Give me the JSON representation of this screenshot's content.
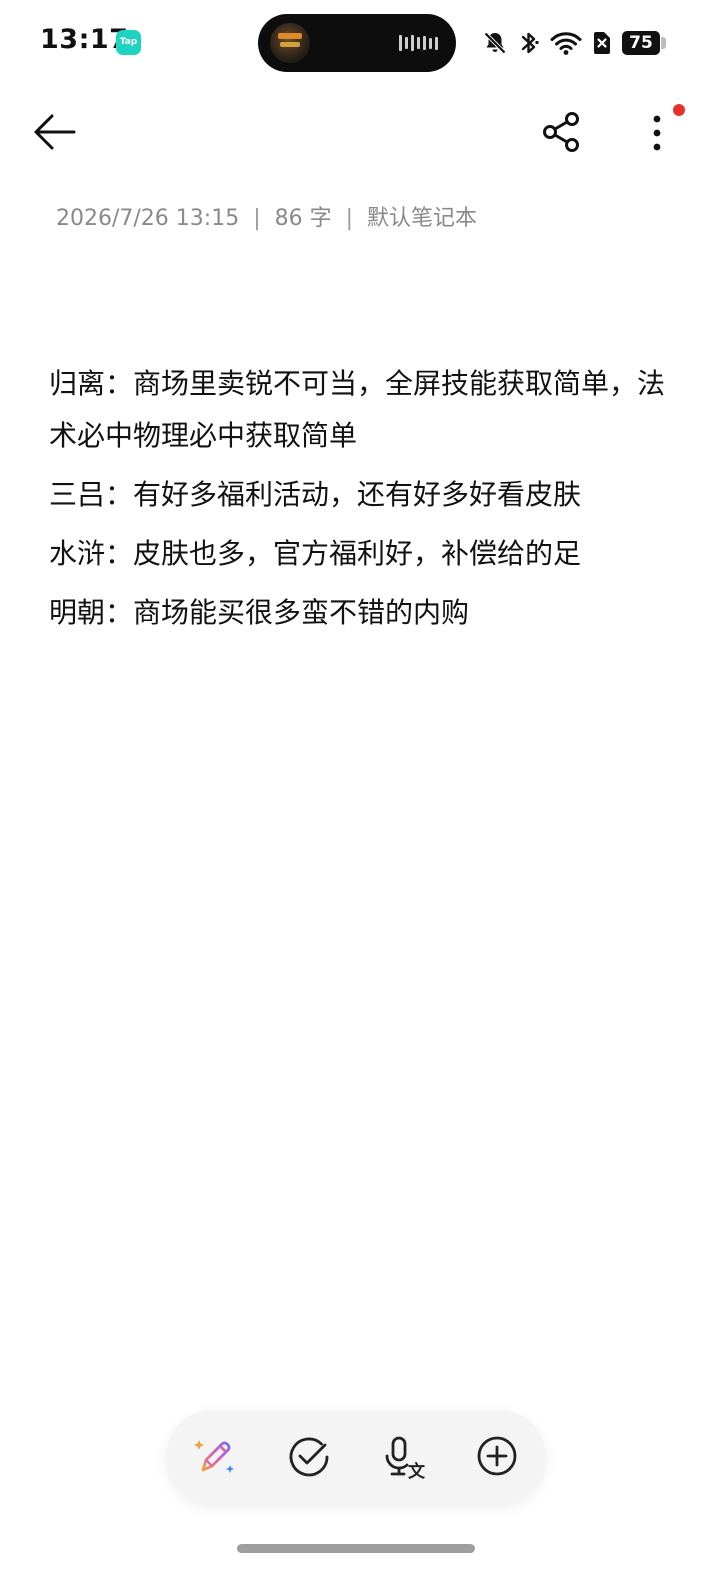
{
  "status_bar": {
    "time": "13:17",
    "app_badge": "Tap",
    "battery_level": "75",
    "icons": [
      "bell-off-icon",
      "bluetooth-icon",
      "wifi-icon",
      "sim-off-icon",
      "battery-icon"
    ]
  },
  "toolbar": {
    "back_icon": "arrow-left-icon",
    "share_icon": "share-icon",
    "more_icon": "more-vertical-icon",
    "notification_dot_color": "#e5322d"
  },
  "meta": {
    "datetime": "2026/7/26 13:15",
    "word_count": "86 字",
    "notebook": "默认笔记本"
  },
  "note": {
    "paragraphs": [
      "归离：商场里卖锐不可当，全屏技能获取简单，法术必中物理必中获取简单",
      "三吕：有好多福利活动，还有好多好看皮肤",
      "水浒：皮肤也多，官方福利好，补偿给的足",
      "明朝：商场能买很多蛮不错的内购"
    ]
  },
  "bottom_bar": {
    "buttons": [
      "ai-write-icon",
      "checklist-icon",
      "voice-to-text-icon",
      "add-icon"
    ]
  }
}
